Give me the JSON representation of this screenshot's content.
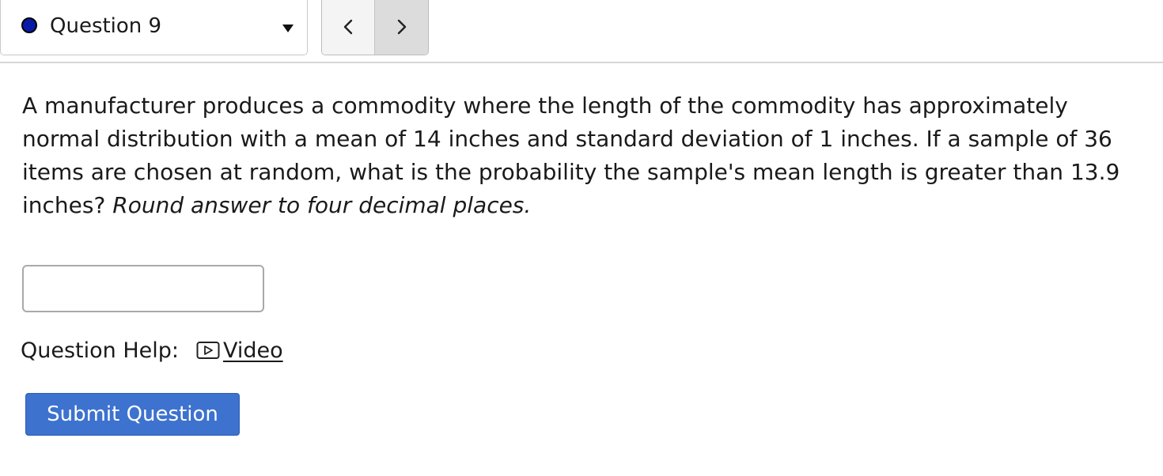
{
  "colors": {
    "status_dot": "#0a1aa8",
    "submit_background": "#3d72cf",
    "submit_text": "#ffffff",
    "divider": "#d6d6d6"
  },
  "header": {
    "question_selector": {
      "label": "Question 9",
      "status_icon": "status-dot-icon",
      "caret_icon": "caret-down-icon"
    },
    "nav": {
      "prev_icon": "chevron-left-icon",
      "next_icon": "chevron-right-icon"
    }
  },
  "question": {
    "body": "A manufacturer produces a commodity where the length of the commodity has approximately normal distribution with a mean of 14 inches and standard deviation of 1 inches. If a sample of 36 items are chosen at random, what is the probability the sample's mean length is greater than 13.9 inches?",
    "instruction": "Round answer to four decimal places."
  },
  "answer": {
    "value": "",
    "placeholder": ""
  },
  "help": {
    "label": "Question Help:",
    "video_label": "Video",
    "video_icon": "play-video-icon"
  },
  "submit": {
    "label": "Submit Question"
  }
}
